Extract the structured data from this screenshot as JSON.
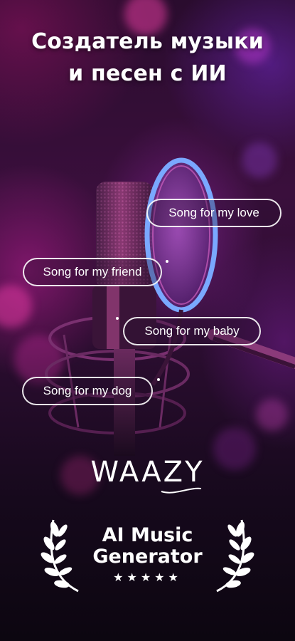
{
  "headline": {
    "line1": "Создатель музыки",
    "line2": "и песен с ИИ"
  },
  "chips": [
    {
      "label": "Song for my love"
    },
    {
      "label": "Song for my friend"
    },
    {
      "label": "Song for my baby"
    },
    {
      "label": "Song for my dog"
    }
  ],
  "brand": {
    "name": "WAAZY"
  },
  "award": {
    "line1": "AI Music",
    "line2": "Generator",
    "stars": "★★★★★",
    "rating": 5
  },
  "icons": {
    "mic": "studio-microphone-icon",
    "laurel_left": "laurel-left-icon",
    "laurel_right": "laurel-right-icon",
    "star": "star-icon"
  },
  "colors": {
    "background": "#2a0c2e",
    "accent_pink": "#e0308a",
    "accent_purple": "#7a3cc8",
    "text": "#ffffff"
  }
}
